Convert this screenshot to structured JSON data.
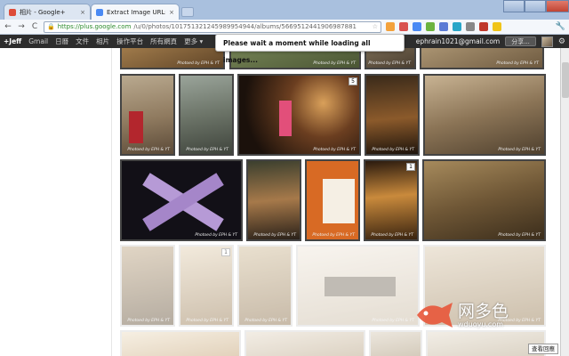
{
  "browser": {
    "tabs": [
      {
        "title": "相片 - Google+",
        "favicon_color": "#dd4b39"
      },
      {
        "title": "Extract Image URLs for Google+",
        "favicon_color": "#4a8af4"
      }
    ],
    "toolbar": {
      "back_glyph": "←",
      "forward_glyph": "→",
      "reload_glyph": "C",
      "lock_glyph": "🔒",
      "url_host": "https://plus.google.com",
      "url_path": "/u/0/photos/101751321245989954944/albums/5669512441906987881",
      "star_glyph": "☆",
      "extensions": [
        {
          "name": "ext-icon-1",
          "color": "#f3a23c"
        },
        {
          "name": "ext-icon-2",
          "color": "#d9534f"
        },
        {
          "name": "ext-icon-3",
          "color": "#4a8af4"
        },
        {
          "name": "ext-icon-4",
          "color": "#6cb33f"
        },
        {
          "name": "ext-icon-5",
          "color": "#5b7bd5"
        },
        {
          "name": "ext-icon-6",
          "color": "#2aa6c8"
        },
        {
          "name": "ext-icon-7",
          "color": "#888888"
        },
        {
          "name": "ext-icon-8",
          "color": "#c0392b"
        },
        {
          "name": "ext-icon-9",
          "color": "#f0c419"
        }
      ],
      "wrench_glyph": "🔧"
    }
  },
  "gbar": {
    "user": "+Jeff",
    "links": [
      "Gmail",
      "日曆",
      "文件",
      "相片",
      "操作平台",
      "所有網頁",
      "更多 ▾"
    ],
    "email": "ephrain1021@gmail.com",
    "share_label": "分享...",
    "gear_glyph": "⚙"
  },
  "notice": {
    "text": "Please wait a moment while loading all images..."
  },
  "gallery": {
    "credit_text": "Photoed by EPH & YT",
    "badges": [
      "5",
      "1",
      "1"
    ]
  },
  "watermark": {
    "cn": "网多色",
    "url": "wduoyu.com"
  },
  "corner_tag": "查看回應",
  "colors": {
    "tabstrip": "#a9c0de",
    "gbar": "#2d2d2d",
    "accent_green": "#2b8a2b"
  }
}
